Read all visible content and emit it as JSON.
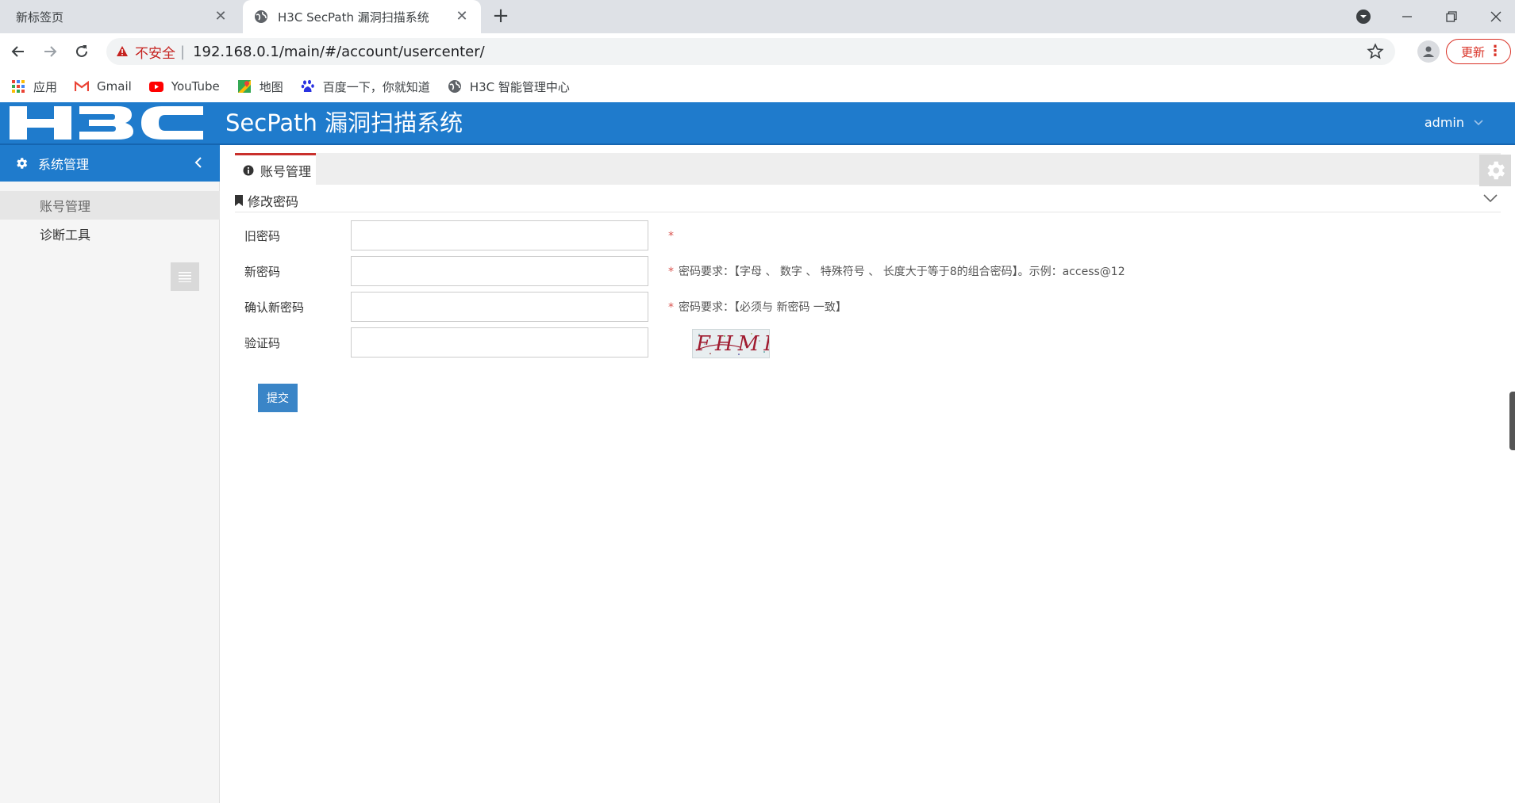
{
  "browser": {
    "tabs": [
      {
        "title": "新标签页",
        "active": false
      },
      {
        "title": "H3C SecPath 漏洞扫描系统",
        "active": true
      }
    ],
    "security_label": "不安全",
    "url": "192.168.0.1/main/#/account/usercenter/",
    "update_label": "更新",
    "bookmarks": [
      {
        "label": "应用",
        "icon": "apps-grid-icon"
      },
      {
        "label": "Gmail",
        "icon": "gmail-icon"
      },
      {
        "label": "YouTube",
        "icon": "youtube-icon"
      },
      {
        "label": "地图",
        "icon": "maps-icon"
      },
      {
        "label": "百度一下，你就知道",
        "icon": "baidu-icon"
      },
      {
        "label": "H3C 智能管理中心",
        "icon": "globe-icon"
      }
    ]
  },
  "app": {
    "logo_text": "H3C",
    "title": "SecPath 漏洞扫描系统",
    "user": "admin",
    "brand_color": "#1f7bcc"
  },
  "sidebar": {
    "header": "系统管理",
    "items": [
      {
        "label": "账号管理",
        "active": true
      },
      {
        "label": "诊断工具",
        "active": false
      }
    ]
  },
  "content": {
    "tab": "账号管理",
    "section_title": "修改密码",
    "form": {
      "old_password_label": "旧密码",
      "old_password_hint_mark": "*",
      "new_password_label": "新密码",
      "new_password_hint": "密码要求：【字母 、 数字 、 特殊符号 、 长度大于等于8的组合密码】。示例：access@12",
      "confirm_password_label": "确认新密码",
      "confirm_password_hint": "密码要求：【必须与 新密码 一致】",
      "captcha_label": "验证码",
      "captcha_text": "FHMB",
      "required_mark": "*",
      "submit_label": "提交"
    }
  }
}
